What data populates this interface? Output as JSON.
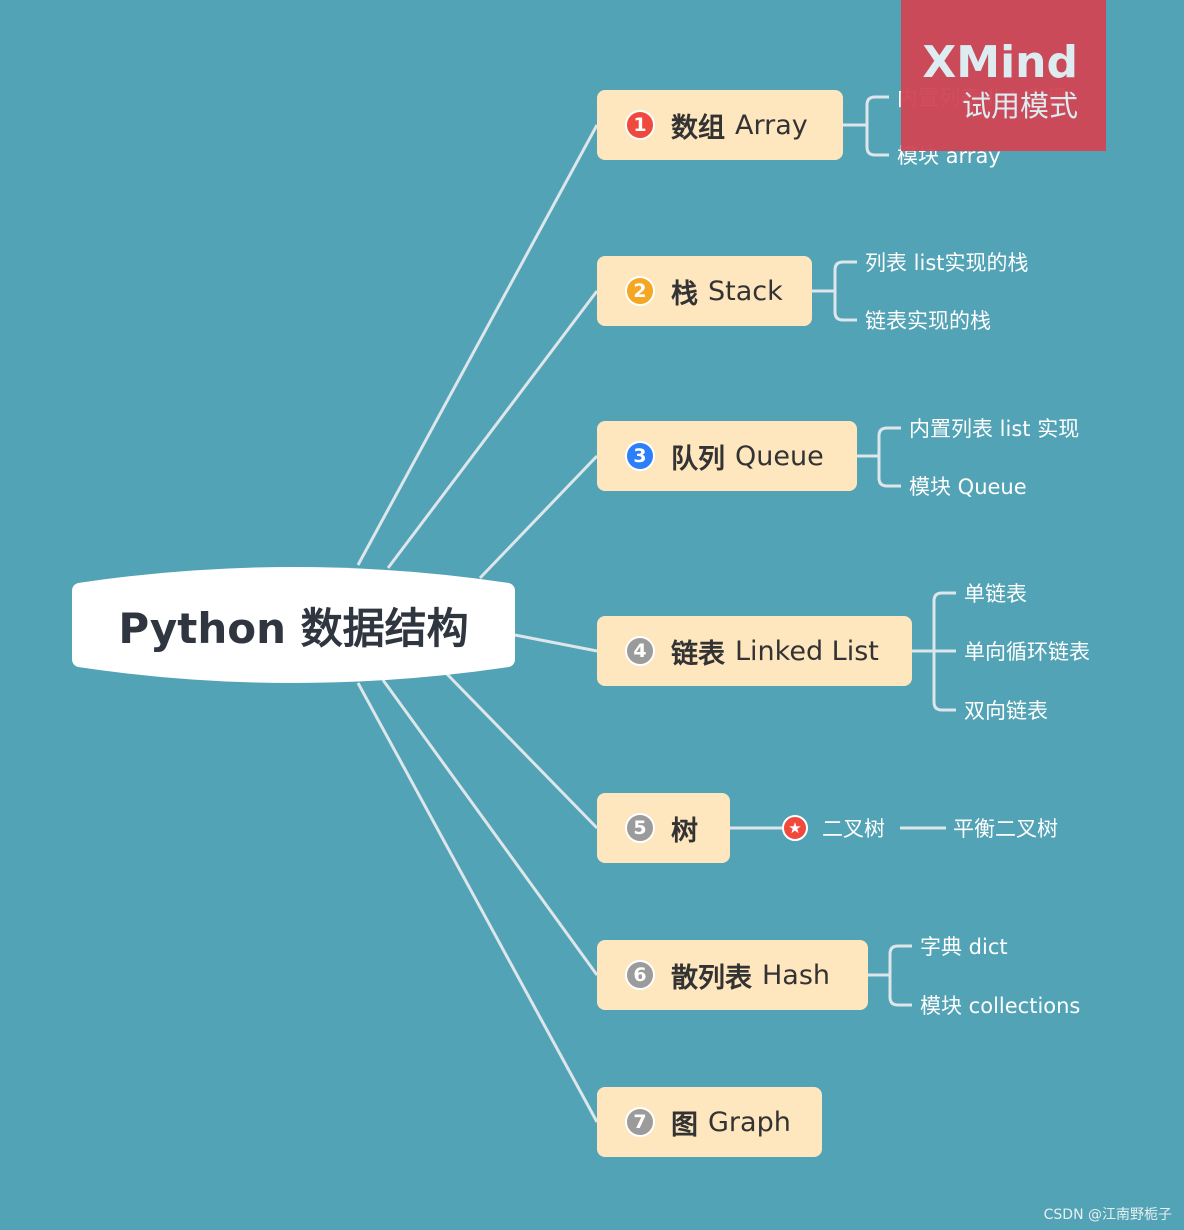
{
  "root": {
    "label": "Python 数据结构"
  },
  "colors": {
    "background": "#52a3b5",
    "topic_fill": "#fee6bf",
    "line": "#dde6ea",
    "badge_red": "#f04a3e",
    "badge_orange": "#f5a623",
    "badge_blue": "#2d7ff9",
    "badge_gray": "#9b9b9b"
  },
  "topics": [
    {
      "num": "1",
      "cn": "数组",
      "en": "Array",
      "badge_color": "#f04a3e",
      "children": [
        "内置列表 list 实现",
        "模块 array"
      ]
    },
    {
      "num": "2",
      "cn": "栈",
      "en": "Stack",
      "badge_color": "#f5a623",
      "children": [
        "列表 list实现的栈",
        "链表实现的栈"
      ]
    },
    {
      "num": "3",
      "cn": "队列",
      "en": "Queue",
      "badge_color": "#2d7ff9",
      "children": [
        "内置列表 list 实现",
        "模块 Queue"
      ]
    },
    {
      "num": "4",
      "cn": "链表",
      "en": "Linked List",
      "badge_color": "#9b9b9b",
      "children": [
        "单链表",
        "单向循环链表",
        "双向链表"
      ]
    },
    {
      "num": "5",
      "cn": "树",
      "en": "",
      "badge_color": "#9b9b9b",
      "children": [
        "二叉树",
        "平衡二叉树"
      ],
      "child_icon": "star-icon"
    },
    {
      "num": "6",
      "cn": "散列表",
      "en": "Hash",
      "badge_color": "#9b9b9b",
      "children": [
        "字典 dict",
        "模块 collections"
      ]
    },
    {
      "num": "7",
      "cn": "图",
      "en": "Graph",
      "badge_color": "#9b9b9b",
      "children": []
    }
  ],
  "watermark": {
    "title": "XMind",
    "subtitle": "试用模式"
  },
  "credit": "CSDN @江南野栀子"
}
